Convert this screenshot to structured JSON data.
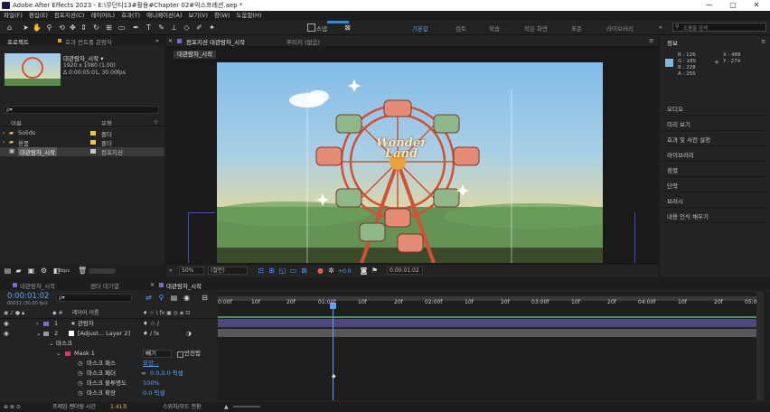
{
  "window": {
    "title": "Adobe After Effects 2023 - E:\\무던디13#활용#Chapter 02#익스프레션.aep *",
    "minimize": "—",
    "maximize": "▢",
    "close": "✕"
  },
  "menu": [
    "파일(F)",
    "편집(E)",
    "컴포지션(C)",
    "레이어(L)",
    "효과(T)",
    "애니메이션(A)",
    "보기(V)",
    "창(W)",
    "도움말(H)"
  ],
  "toolbar": {
    "snap_label": "스냅",
    "workspaces": [
      "기본값",
      "검토",
      "학습",
      "작은 화면",
      "표준",
      "라이브러리"
    ],
    "active_workspace": "기본값",
    "search_placeholder": "도움말 검색"
  },
  "project": {
    "tab_project": "프로젝트",
    "tab_effects": "효과 컨트롤 관람차",
    "comp_name": "대관람차_시작 ▾",
    "comp_res": "1920 x 1080 (1.00)",
    "comp_dur": "Δ 0:00:05:01, 30.00fps",
    "search_placeholder": "ρ▾",
    "col_name": "이름",
    "col_type": "유형",
    "items": [
      {
        "name": "Solids",
        "type": "폴더",
        "color": "#e6c84a"
      },
      {
        "name": "용품",
        "type": "폴더",
        "color": "#e6c84a"
      },
      {
        "name": "대관람차_시작",
        "type": "컴포지션",
        "color": "#c8c8c8"
      }
    ],
    "bpc": "8bpc"
  },
  "viewer": {
    "tab_comp": "컴포지션 대관람차_시작",
    "tab_footage": "푸티지 (없음)",
    "breadcrumb": "대관람차_시작",
    "zoom": "50%",
    "resolution": "(절반)",
    "exposure": "+0.0",
    "timecode": "0:00:01:02",
    "sign_text_1": "Wonder",
    "sign_text_2": "Land"
  },
  "info": {
    "title": "정보",
    "r": "R : 126",
    "g": "G : 185",
    "b": "B : 228",
    "a": "A : 255",
    "x": "X : 488",
    "y": "Y : 274",
    "swatch": "#7eb9e4",
    "panels": [
      "오디오",
      "미리 보기",
      "효과 및 사전 설정",
      "라이브러리",
      "정렬",
      "단락",
      "브러시",
      "내용 인식 채우기"
    ]
  },
  "timeline": {
    "tab_render": "렌더 대기열",
    "tab_comp": "대관람차_시작",
    "timecode": "0:00:01:02",
    "timecode_sub": "00032 (30.00 fps)",
    "search_placeholder": "ρ▾",
    "col_layer": "레이어 이름",
    "col_parent": "상위 및 링크",
    "ruler": [
      "0:00f",
      "10f",
      "20f",
      "01:00f",
      "10f",
      "20f",
      "02:00f",
      "10f",
      "20f",
      "03:00f",
      "10f",
      "20f",
      "04:00f",
      "10f",
      "20f",
      "05:0"
    ],
    "layers": [
      {
        "num": "1",
        "name": "★ 관람차",
        "parent": "없음",
        "color": "#7a6bd0"
      },
      {
        "num": "2",
        "name": "[Adjust... Layer 2]",
        "parent": "없음",
        "color": "#9a9a9a"
      }
    ],
    "mask_group": "마스크",
    "mask_name": "Mask 1",
    "mask_mode": "빼기",
    "mask_invert": "반전됨",
    "mask_props": [
      {
        "label": "마스크 패스",
        "value": "모양..."
      },
      {
        "label": "마스크 페더",
        "value": "0.0,0.0 픽셀"
      },
      {
        "label": "마스크 불투명도",
        "value": "100%"
      },
      {
        "label": "마스크 확장",
        "value": "0.0 픽셀"
      }
    ],
    "footer_left": "프레임 렌더링 시간",
    "footer_time": "1.41초",
    "footer_right": "스위치/모드 전환"
  }
}
